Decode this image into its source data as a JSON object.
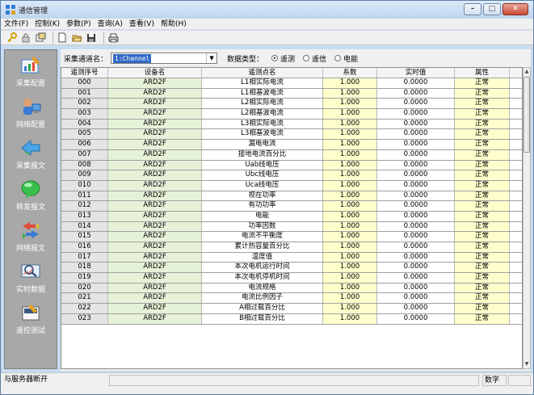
{
  "window": {
    "title": "通信管理",
    "buttons": [
      "–",
      "□",
      "✕"
    ]
  },
  "menu": [
    "文件(F)",
    "控制(K)",
    "参数(P)",
    "查询(A)",
    "查看(V)",
    "帮助(H)"
  ],
  "toolbar": [
    "key-icon",
    "lock-icon",
    "print-preview-icon",
    "new-file-icon",
    "open-folder-icon",
    "save-icon",
    "print-icon"
  ],
  "sidebar": [
    {
      "label": "采集配置",
      "icon": "collect-config-icon"
    },
    {
      "label": "网络配置",
      "icon": "network-config-icon"
    },
    {
      "label": "采集报文",
      "icon": "collect-message-icon"
    },
    {
      "label": "转发报文",
      "icon": "forward-message-icon"
    },
    {
      "label": "网络报文",
      "icon": "network-message-icon"
    },
    {
      "label": "实时数据",
      "icon": "realtime-data-icon"
    },
    {
      "label": "遥控测试",
      "icon": "remote-control-test-icon"
    }
  ],
  "filter": {
    "channel_label": "采集通道名：",
    "channel_value": "1:Channel",
    "type_label": "数据类型：",
    "radios": [
      {
        "label": "遥测",
        "checked": true
      },
      {
        "label": "遥信",
        "checked": false
      },
      {
        "label": "电能",
        "checked": false
      }
    ]
  },
  "table": {
    "headers": [
      "遥测序号",
      "设备名",
      "遥测点名",
      "系数",
      "实时值",
      "属性"
    ],
    "rows": [
      [
        "000",
        "ARD2F",
        "L1相实际电流",
        "1.000",
        "0.0000",
        "正常"
      ],
      [
        "001",
        "ARD2F",
        "L1相基波电流",
        "1.000",
        "0.0000",
        "正常"
      ],
      [
        "002",
        "ARD2F",
        "L2相实际电流",
        "1.000",
        "0.0000",
        "正常"
      ],
      [
        "003",
        "ARD2F",
        "L2相基波电流",
        "1.000",
        "0.0000",
        "正常"
      ],
      [
        "004",
        "ARD2F",
        "L3相实际电流",
        "1.000",
        "0.0000",
        "正常"
      ],
      [
        "005",
        "ARD2F",
        "L3相基波电流",
        "1.000",
        "0.0000",
        "正常"
      ],
      [
        "006",
        "ARD2F",
        "漏电电流",
        "1.000",
        "0.0000",
        "正常"
      ],
      [
        "007",
        "ARD2F",
        "接地电流百分比",
        "1.000",
        "0.0000",
        "正常"
      ],
      [
        "008",
        "ARD2F",
        "Uab线电压",
        "1.000",
        "0.0000",
        "正常"
      ],
      [
        "009",
        "ARD2F",
        "Ubc线电压",
        "1.000",
        "0.0000",
        "正常"
      ],
      [
        "010",
        "ARD2F",
        "Uca线电压",
        "1.000",
        "0.0000",
        "正常"
      ],
      [
        "011",
        "ARD2F",
        "视在功率",
        "1.000",
        "0.0000",
        "正常"
      ],
      [
        "012",
        "ARD2F",
        "有功功率",
        "1.000",
        "0.0000",
        "正常"
      ],
      [
        "013",
        "ARD2F",
        "电能",
        "1.000",
        "0.0000",
        "正常"
      ],
      [
        "014",
        "ARD2F",
        "功率因数",
        "1.000",
        "0.0000",
        "正常"
      ],
      [
        "015",
        "ARD2F",
        "电流不平衡度",
        "1.000",
        "0.0000",
        "正常"
      ],
      [
        "016",
        "ARD2F",
        "累计热容量百分比",
        "1.000",
        "0.0000",
        "正常"
      ],
      [
        "017",
        "ARD2F",
        "温度值",
        "1.000",
        "0.0000",
        "正常"
      ],
      [
        "018",
        "ARD2F",
        "本次电机运行时间",
        "1.000",
        "0.0000",
        "正常"
      ],
      [
        "019",
        "ARD2F",
        "本次电机停机时间",
        "1.000",
        "0.0000",
        "正常"
      ],
      [
        "020",
        "ARD2F",
        "电流规格",
        "1.000",
        "0.0000",
        "正常"
      ],
      [
        "021",
        "ARD2F",
        "电流比例因子",
        "1.000",
        "0.0000",
        "正常"
      ],
      [
        "022",
        "ARD2F",
        "A相过载百分比",
        "1.000",
        "0.0000",
        "正常"
      ],
      [
        "023",
        "ARD2F",
        "B相过载百分比",
        "1.000",
        "0.0000",
        "正常"
      ]
    ]
  },
  "status": {
    "left": "与服务器断开",
    "right": "数字"
  },
  "colors": {
    "sidebar_bg": "#a8a8a8",
    "coef_bg": "#ffffcc",
    "device_bg": "#e6f2d8",
    "seq_bg": "#e4e4e4",
    "selected": "#3169c6"
  }
}
